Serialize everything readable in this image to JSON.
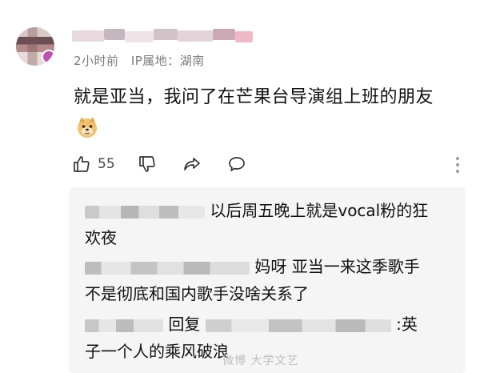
{
  "comment": {
    "time": "2小时前",
    "ip_location": "IP属地：湖南",
    "text": "就是亚当，我问了在芒果台导演组上班的朋友",
    "emoji": "doge-emoji",
    "likes": "55"
  },
  "replies": [
    {
      "line1": "以后周五晚上就是vocal粉的狂",
      "line2": "欢夜"
    },
    {
      "line1": "妈呀 亚当一来这季歌手",
      "line2": "不是彻底和国内歌手没啥关系了"
    },
    {
      "reply_prefix": "回复",
      "line1": ":英",
      "line2": "子一个人的乘风破浪"
    }
  ],
  "watermark": "微博 大学文艺",
  "icons": {
    "like": "thumbs-up-icon",
    "dislike": "thumbs-down-icon",
    "share": "share-icon",
    "comment": "comment-icon",
    "more": "more-vertical-icon"
  },
  "colors": {
    "text": "#111111",
    "meta": "#7a7a7a",
    "panel": "#f5f5f5",
    "badge": "#c44fb3"
  }
}
